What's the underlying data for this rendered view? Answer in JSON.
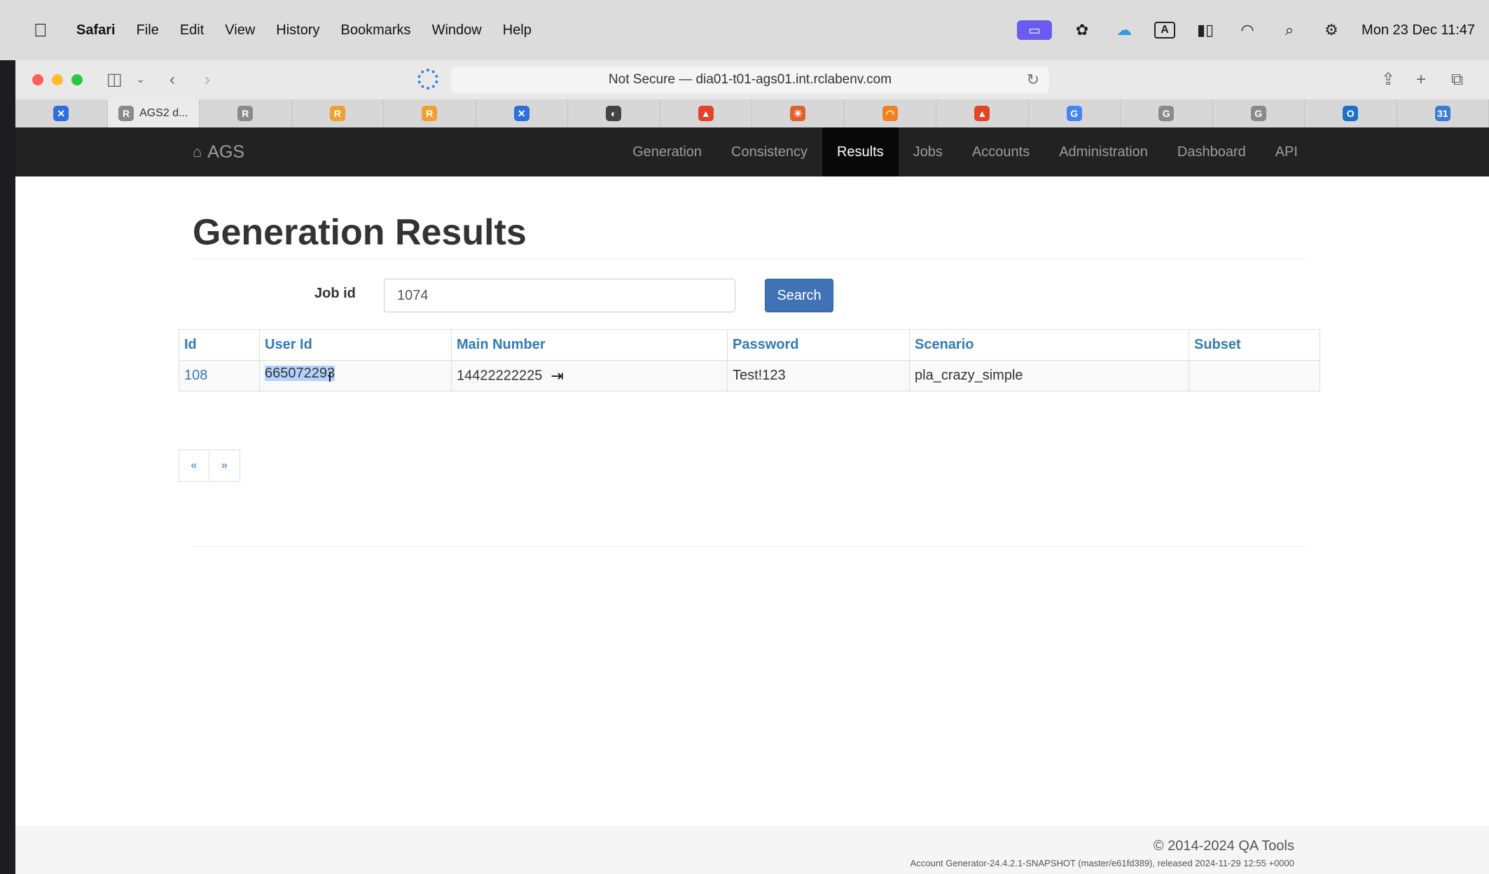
{
  "menubar": {
    "app_name": "Safari",
    "items": [
      "File",
      "Edit",
      "View",
      "History",
      "Bookmarks",
      "Window",
      "Help"
    ],
    "status_icons": [
      "screen-share-icon",
      "focus-icon",
      "cloud-icon",
      "keyboard-input-icon",
      "battery-icon",
      "wifi-icon",
      "spotlight-search-icon",
      "control-center-icon"
    ],
    "keyboard_input": "A",
    "clock": "Mon 23 Dec  11:47"
  },
  "browser": {
    "address": "Not Secure — dia01-t01-ags01.int.rclabenv.com",
    "active_tab_label": "AGS2 d...",
    "tabs": [
      {
        "icon": "confluence-icon",
        "color": "#2e6fe0",
        "glyph": "✕"
      },
      {
        "icon": "ags-favicon",
        "color": "#8a8a8a",
        "glyph": "R",
        "label": "AGS2 d..."
      },
      {
        "icon": "r-favicon",
        "color": "#8a8a8a",
        "glyph": "R"
      },
      {
        "icon": "rc-favicon",
        "color": "#f0a030",
        "glyph": "R"
      },
      {
        "icon": "rc-favicon",
        "color": "#f0a030",
        "glyph": "R"
      },
      {
        "icon": "confluence-icon",
        "color": "#2e6fe0",
        "glyph": "✕"
      },
      {
        "icon": "tool-icon",
        "color": "#444444",
        "glyph": "◐"
      },
      {
        "icon": "gitlab-icon",
        "color": "#e24329",
        "glyph": "▲"
      },
      {
        "icon": "asterisk-icon",
        "color": "#e06030",
        "glyph": "✳"
      },
      {
        "icon": "loader-icon",
        "color": "#f08020",
        "glyph": "◠"
      },
      {
        "icon": "gitlab-icon",
        "color": "#e24329",
        "glyph": "▲"
      },
      {
        "icon": "google-icon",
        "color": "#4285f4",
        "glyph": "G"
      },
      {
        "icon": "g-favicon",
        "color": "#8a8a8a",
        "glyph": "G"
      },
      {
        "icon": "g-favicon",
        "color": "#8a8a8a",
        "glyph": "G"
      },
      {
        "icon": "outlook-icon",
        "color": "#1f6fc8",
        "glyph": "O"
      },
      {
        "icon": "calendar-icon",
        "color": "#3a7bd5",
        "glyph": "31"
      }
    ]
  },
  "navbar": {
    "brand": "AGS",
    "items": [
      "Generation",
      "Consistency",
      "Results",
      "Jobs",
      "Accounts",
      "Administration",
      "Dashboard",
      "API"
    ],
    "active": "Results"
  },
  "page": {
    "title": "Generation Results",
    "job_label": "Job id",
    "job_value": "1074",
    "search_label": "Search"
  },
  "table": {
    "headers": [
      "Id",
      "User Id",
      "Main Number",
      "Password",
      "Scenario",
      "Subset"
    ],
    "rows": [
      {
        "id": "108",
        "user_id": "665072293",
        "main_number": "14422222225",
        "password": "Test!123",
        "scenario": "pla_crazy_simple",
        "subset": ""
      }
    ]
  },
  "pager": {
    "prev": "«",
    "next": "»"
  },
  "footer": {
    "copyright": "© 2014-2024 QA Tools",
    "version": "Account Generator-24.4.2.1-SNAPSHOT (master/e61fd389), released 2024-11-29 12:55 +0000"
  }
}
